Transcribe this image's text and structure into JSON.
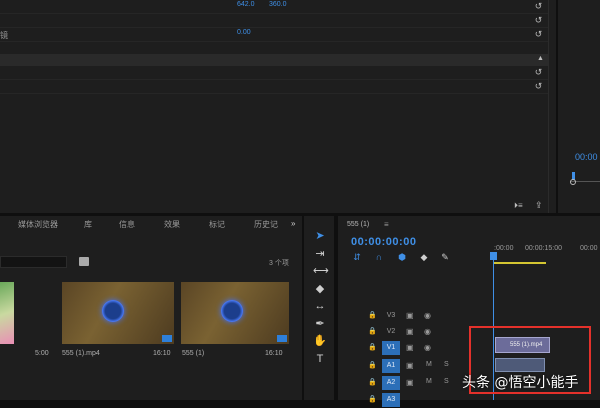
{
  "effect_controls": {
    "rows": [
      {
        "label": "",
        "v1": "642.0",
        "v2": "360.0"
      },
      {
        "label": "镜",
        "v1": "0.00",
        "v2": ""
      },
      {
        "label": "",
        "v1": "",
        "v2": ""
      }
    ],
    "reset_glyph": "↺"
  },
  "program_monitor": {
    "timecode": "00:00"
  },
  "project_panel": {
    "tabs": [
      "媒体浏览器",
      "库",
      "信息",
      "效果",
      "标记",
      "历史记"
    ],
    "tab_overflow": "»",
    "item_count": "3 个项",
    "clips": [
      {
        "name": "",
        "duration": "5:00"
      },
      {
        "name": "555 (1).mp4",
        "duration": "16:10"
      },
      {
        "name": "555 (1)",
        "duration": "16:10"
      }
    ]
  },
  "tools": [
    "selection-tool",
    "track-select-tool",
    "ripple-edit-tool",
    "razor-tool",
    "slip-tool",
    "pen-tool",
    "hand-tool",
    "type-tool"
  ],
  "timeline": {
    "sequence_tab": "555 (1)",
    "timecode": "00:00:00:00",
    "ruler": [
      ":00:00",
      "00:00:15:00",
      "00:00"
    ],
    "tracks": [
      {
        "name": "V3",
        "kind": "video",
        "active": false
      },
      {
        "name": "V2",
        "kind": "video",
        "active": false
      },
      {
        "name": "V1",
        "kind": "video",
        "active": true
      },
      {
        "name": "A1",
        "kind": "audio",
        "active": true
      },
      {
        "name": "A2",
        "kind": "audio",
        "active": true
      },
      {
        "name": "A3",
        "kind": "audio",
        "active": true
      }
    ],
    "clip_label": "555 (1).mp4",
    "mute_label": "M",
    "solo_label": "S"
  },
  "watermark": "头条 @悟空小能手",
  "colors": {
    "accent": "#3f8fe6",
    "highlight_box": "#e4312b",
    "work_area": "#d4c632"
  }
}
